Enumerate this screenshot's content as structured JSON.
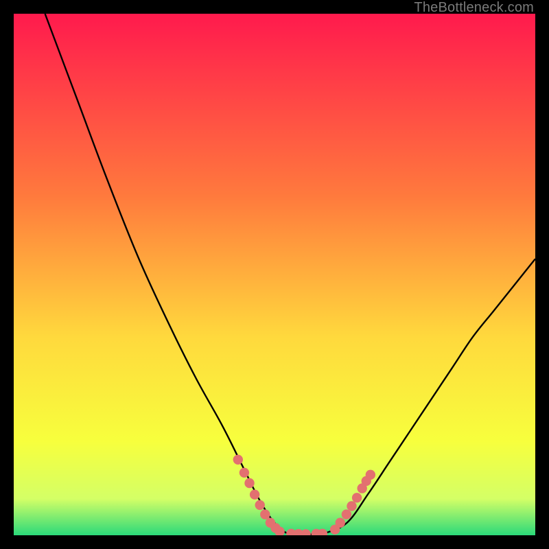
{
  "attribution": "TheBottleneck.com",
  "colors": {
    "bg_black": "#000000",
    "grad_top": "#ff1a4d",
    "grad_mid1": "#ff7a3d",
    "grad_mid2": "#ffd93d",
    "grad_low1": "#f7ff3d",
    "grad_low2": "#d4ff66",
    "grad_bottom": "#2bd97a",
    "curve": "#000000",
    "marker": "#e37070"
  },
  "chart_data": {
    "type": "line",
    "title": "",
    "xlabel": "",
    "ylabel": "",
    "xlim": [
      0,
      100
    ],
    "ylim": [
      0,
      100
    ],
    "legend": false,
    "grid": false,
    "series": [
      {
        "name": "bottleneck-curve",
        "x": [
          6,
          12,
          18,
          24,
          30,
          35,
          40,
          44,
          47,
          49.5,
          52,
          54,
          56,
          58,
          60,
          64,
          68,
          72,
          76,
          80,
          84,
          88,
          92,
          96,
          100
        ],
        "y": [
          100,
          84,
          68,
          53,
          40,
          30,
          21,
          13,
          7,
          3,
          0.6,
          0.3,
          0.2,
          0.2,
          0.5,
          2.5,
          8,
          14,
          20,
          26,
          32,
          38,
          43,
          48,
          53
        ]
      }
    ],
    "markers": [
      {
        "x": 43.0,
        "y": 14.5
      },
      {
        "x": 44.2,
        "y": 12.0
      },
      {
        "x": 45.2,
        "y": 10.0
      },
      {
        "x": 46.2,
        "y": 7.8
      },
      {
        "x": 47.2,
        "y": 5.8
      },
      {
        "x": 48.2,
        "y": 4.0
      },
      {
        "x": 49.2,
        "y": 2.4
      },
      {
        "x": 50.2,
        "y": 1.4
      },
      {
        "x": 51.0,
        "y": 0.7
      },
      {
        "x": 53.2,
        "y": 0.3
      },
      {
        "x": 54.6,
        "y": 0.25
      },
      {
        "x": 56.0,
        "y": 0.22
      },
      {
        "x": 58.0,
        "y": 0.28
      },
      {
        "x": 59.2,
        "y": 0.3
      },
      {
        "x": 61.6,
        "y": 1.1
      },
      {
        "x": 62.6,
        "y": 2.4
      },
      {
        "x": 63.8,
        "y": 4.0
      },
      {
        "x": 64.8,
        "y": 5.6
      },
      {
        "x": 65.8,
        "y": 7.2
      },
      {
        "x": 66.8,
        "y": 9.0
      },
      {
        "x": 67.6,
        "y": 10.4
      },
      {
        "x": 68.4,
        "y": 11.6
      }
    ]
  }
}
